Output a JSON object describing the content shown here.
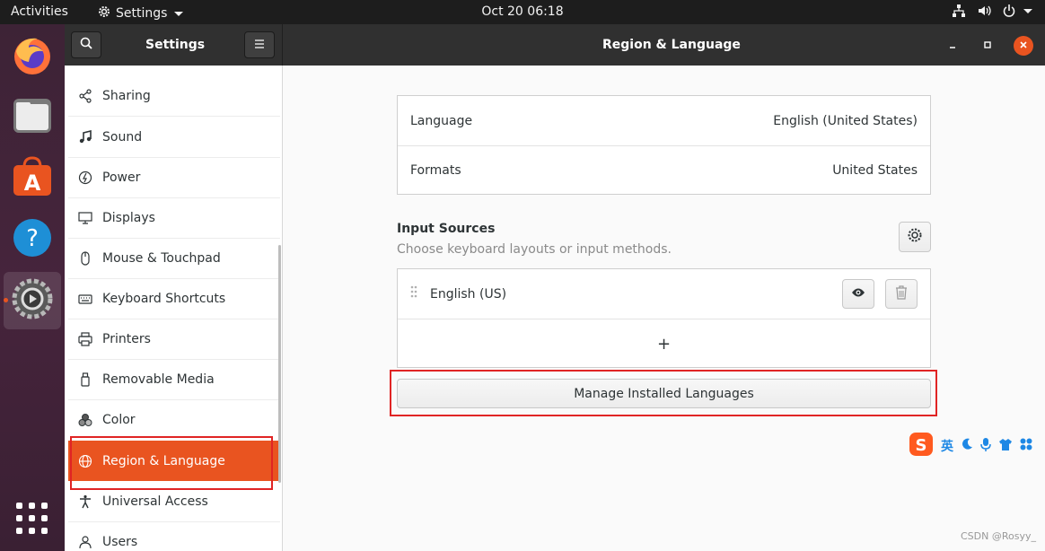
{
  "topbar": {
    "activities": "Activities",
    "app_menu": "Settings",
    "clock": "Oct 20  06:18"
  },
  "window": {
    "sidebar_title": "Settings",
    "page_title": "Region & Language"
  },
  "sidebar": {
    "items": [
      {
        "label": "Sharing",
        "icon": "share-icon"
      },
      {
        "label": "Sound",
        "icon": "music-note-icon"
      },
      {
        "label": "Power",
        "icon": "power-icon"
      },
      {
        "label": "Displays",
        "icon": "display-icon"
      },
      {
        "label": "Mouse & Touchpad",
        "icon": "mouse-icon"
      },
      {
        "label": "Keyboard Shortcuts",
        "icon": "keyboard-icon"
      },
      {
        "label": "Printers",
        "icon": "printer-icon"
      },
      {
        "label": "Removable Media",
        "icon": "usb-icon"
      },
      {
        "label": "Color",
        "icon": "color-icon"
      },
      {
        "label": "Region & Language",
        "icon": "globe-icon",
        "selected": true
      },
      {
        "label": "Universal Access",
        "icon": "accessibility-icon"
      },
      {
        "label": "Users",
        "icon": "users-icon"
      }
    ]
  },
  "region": {
    "language_label": "Language",
    "language_value": "English (United States)",
    "formats_label": "Formats",
    "formats_value": "United States"
  },
  "input_sources": {
    "title": "Input Sources",
    "subtitle": "Choose keyboard layouts or input methods.",
    "sources": [
      {
        "label": "English (US)"
      }
    ],
    "add_label": "+"
  },
  "manage_button": "Manage Installed Languages",
  "ime_bar": {
    "text": "英"
  },
  "watermark": "CSDN @Rosyy_",
  "colors": {
    "accent": "#e95420",
    "highlight": "#e02424",
    "headerbar": "#303030",
    "topbar": "#1d1d1d"
  }
}
